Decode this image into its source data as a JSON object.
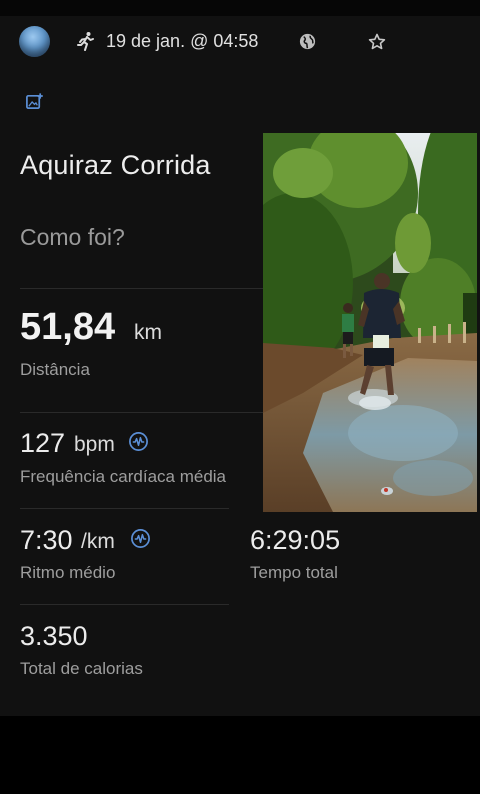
{
  "header": {
    "avatar": "profile-avatar",
    "activity_icon": "running-icon",
    "date": "19 de jan. @ 04:58",
    "privacy_icon": "globe-icon",
    "favorite_icon": "star-outline-icon"
  },
  "add_photo_icon": "add-photo-icon",
  "activity": {
    "title": "Aquiraz Corrida",
    "prompt": "Como foi?"
  },
  "stats": {
    "distance": {
      "value": "51,84",
      "unit": "km",
      "label": "Distância"
    },
    "heart_rate": {
      "value": "127",
      "unit": "bpm",
      "label": "Frequência cardíaca média"
    },
    "pace": {
      "value": "7:30",
      "unit": "/km",
      "label": "Ritmo médio"
    },
    "total_time": {
      "value": "6:29:05",
      "label": "Tempo total"
    },
    "calories": {
      "value": "3.350",
      "label": "Total de calorias"
    }
  },
  "photo": {
    "alt": "Runner on muddy jungle trail"
  },
  "colors": {
    "background": "#111111",
    "accent": "#5b8fd6",
    "divider": "#2a2a2a"
  }
}
